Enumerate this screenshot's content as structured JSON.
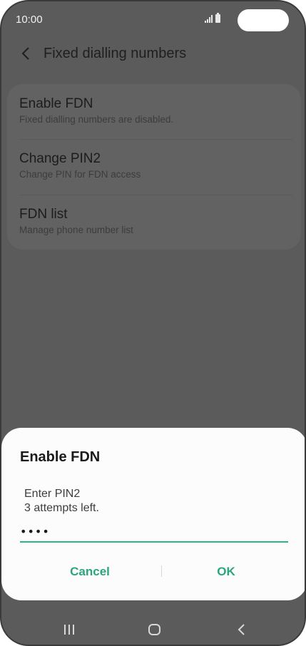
{
  "status_bar": {
    "time": "10:00"
  },
  "app_bar": {
    "title": "Fixed dialling numbers"
  },
  "settings": [
    {
      "title": "Enable FDN",
      "subtitle": "Fixed dialling numbers are disabled."
    },
    {
      "title": "Change PIN2",
      "subtitle": "Change PIN for FDN access"
    },
    {
      "title": "FDN list",
      "subtitle": "Manage phone number list"
    }
  ],
  "dialog": {
    "title": "Enable FDN",
    "message_line1": "Enter PIN2",
    "message_line2": "3 attempts left.",
    "pin_value": "••••",
    "cancel_label": "Cancel",
    "ok_label": "OK",
    "accent_color": "#2ba57a"
  },
  "nav_bar": {
    "icons": [
      "recent-apps-icon",
      "home-icon",
      "back-icon"
    ]
  }
}
